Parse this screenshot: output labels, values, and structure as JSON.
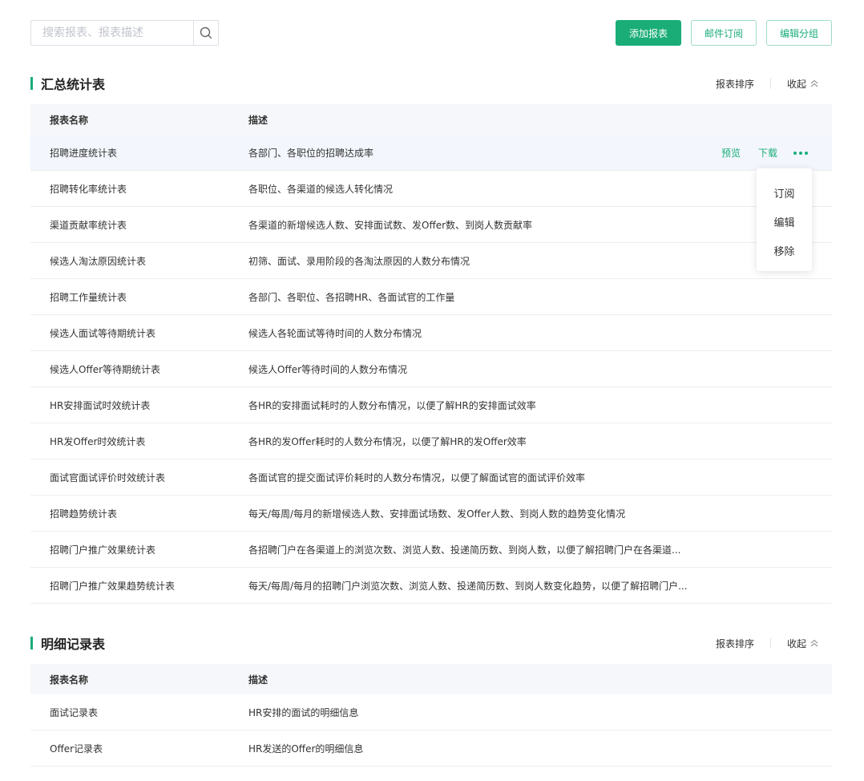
{
  "toolbar": {
    "search_placeholder": "搜索报表、报表描述",
    "add_label": "添加报表",
    "subscribe_label": "邮件订阅",
    "edit_group_label": "编辑分组"
  },
  "summary": {
    "title": "汇总统计表",
    "sort_label": "报表排序",
    "collapse_label": "收起",
    "headers": {
      "name": "报表名称",
      "desc": "描述"
    },
    "rows": [
      {
        "name": "招聘进度统计表",
        "desc": "各部门、各职位的招聘达成率"
      },
      {
        "name": "招聘转化率统计表",
        "desc": "各职位、各渠道的候选人转化情况"
      },
      {
        "name": "渠道贡献率统计表",
        "desc": "各渠道的新增候选人数、安排面试数、发Offer数、到岗人数贡献率"
      },
      {
        "name": "候选人淘汰原因统计表",
        "desc": "初筛、面试、录用阶段的各淘汰原因的人数分布情况"
      },
      {
        "name": "招聘工作量统计表",
        "desc": "各部门、各职位、各招聘HR、各面试官的工作量"
      },
      {
        "name": "候选人面试等待期统计表",
        "desc": "候选人各轮面试等待时间的人数分布情况"
      },
      {
        "name": "候选人Offer等待期统计表",
        "desc": "候选人Offer等待时间的人数分布情况"
      },
      {
        "name": "HR安排面试时效统计表",
        "desc": "各HR的安排面试耗时的人数分布情况，以便了解HR的安排面试效率"
      },
      {
        "name": "HR发Offer时效统计表",
        "desc": "各HR的发Offer耗时的人数分布情况，以便了解HR的发Offer效率"
      },
      {
        "name": "面试官面试评价时效统计表",
        "desc": "各面试官的提交面试评价耗时的人数分布情况，以便了解面试官的面试评价效率"
      },
      {
        "name": "招聘趋势统计表",
        "desc": "每天/每周/每月的新增候选人数、安排面试场数、发Offer人数、到岗人数的趋势变化情况"
      },
      {
        "name": "招聘门户推广效果统计表",
        "desc": "各招聘门户在各渠道上的浏览次数、浏览人数、投递简历数、到岗人数，以便了解招聘门户在各渠道..."
      },
      {
        "name": "招聘门户推广效果趋势统计表",
        "desc": "每天/每周/每月的招聘门户浏览次数、浏览人数、投递简历数、到岗人数变化趋势，以便了解招聘门户..."
      }
    ],
    "row_ops": {
      "preview": "预览",
      "download": "下载"
    }
  },
  "dropdown": {
    "subscribe": "订阅",
    "edit": "编辑",
    "remove": "移除"
  },
  "detail": {
    "title": "明细记录表",
    "sort_label": "报表排序",
    "collapse_label": "收起",
    "headers": {
      "name": "报表名称",
      "desc": "描述"
    },
    "rows": [
      {
        "name": "面试记录表",
        "desc": "HR安排的面试的明细信息"
      },
      {
        "name": "Offer记录表",
        "desc": "HR发送的Offer的明细信息"
      }
    ]
  }
}
